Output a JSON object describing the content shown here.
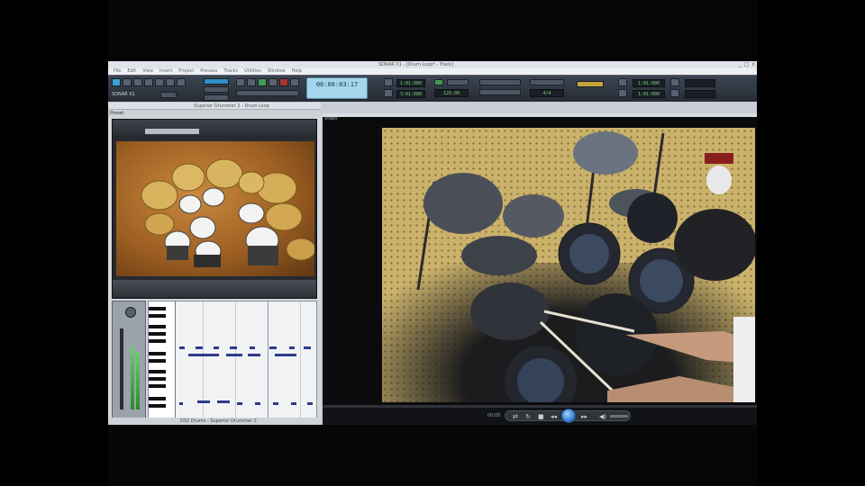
{
  "app": {
    "title": "SONAR X1 - [Drum Loop* - Track]",
    "window_buttons": [
      "_",
      "□",
      "x"
    ],
    "menu": [
      "File",
      "Edit",
      "View",
      "Insert",
      "Project",
      "Process",
      "Tracks",
      "Utilities",
      "Window",
      "Help"
    ]
  },
  "control_bar": {
    "time": "00:00:03:17",
    "toolbox_label": "SONAR X1",
    "lcd_readouts": [
      "1:01:000",
      "3:01:000",
      "120.00",
      "4/4",
      "1:01:000",
      "1:01:000"
    ]
  },
  "console": {
    "title": "Superior Drummer 2 - Drum Loop",
    "preset_label": "Preset",
    "status": "DS2 Drums - Superior Drummer 2"
  },
  "video": {
    "label": "Video",
    "time": "00:05",
    "progress": 0.0,
    "buttons": [
      "shuffle-icon",
      "repeat-icon",
      "stop-icon",
      "prev-icon",
      "play-icon",
      "next-icon",
      "volume-icon"
    ]
  },
  "colors": {
    "accent": "#3aa2d8",
    "note": "#2d3a8a",
    "time_display": "#a6d6ec"
  }
}
